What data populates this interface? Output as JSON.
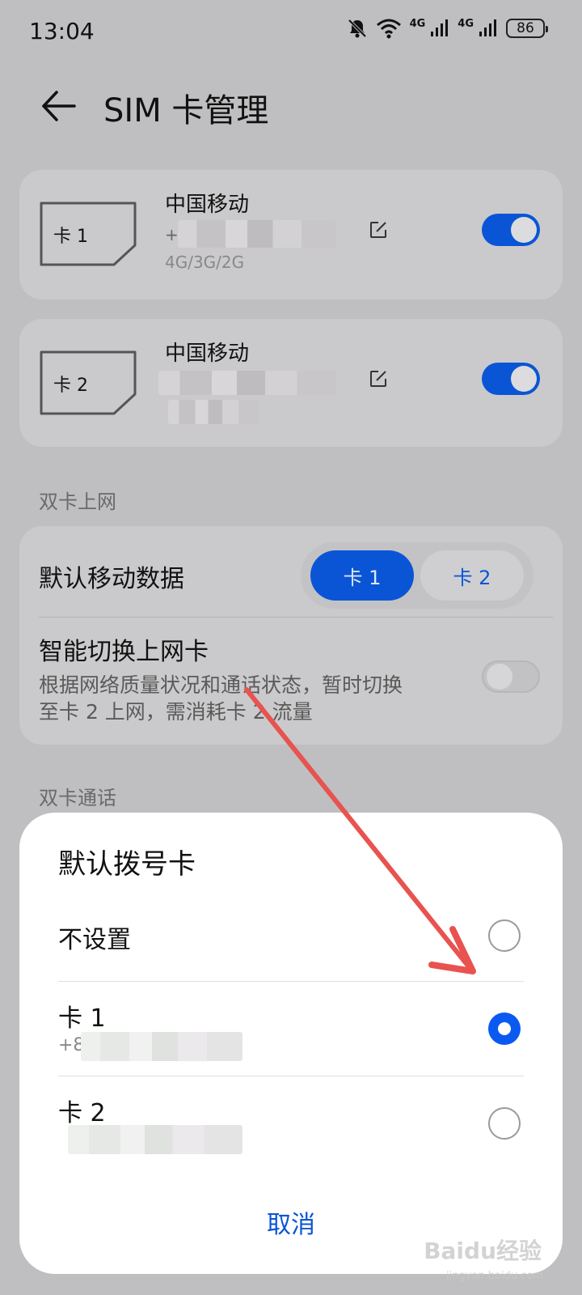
{
  "status_bar": {
    "time": "13:04",
    "net1": "4G",
    "net2": "4G",
    "battery": "86"
  },
  "header": {
    "title": "SIM 卡管理"
  },
  "sim1": {
    "label": "卡 1",
    "carrier": "中国移动",
    "number_prefix": "+",
    "network": "4G/3G/2G",
    "enabled": true
  },
  "sim2": {
    "label": "卡 2",
    "carrier": "中国移动",
    "enabled": true
  },
  "dual_data": {
    "section": "双卡上网",
    "default_data_label": "默认移动数据",
    "seg_card1": "卡 1",
    "seg_card2": "卡 2",
    "selected": "卡 1",
    "smart_switch_title": "智能切换上网卡",
    "smart_switch_desc1": "根据网络质量状况和通话状态，暂时切换",
    "smart_switch_desc2": "至卡 2 上网，需消耗卡 2 流量",
    "smart_switch_enabled": false
  },
  "dual_call": {
    "section": "双卡通话"
  },
  "dialog": {
    "title": "默认拨号卡",
    "options": [
      {
        "label": "不设置",
        "selected": false
      },
      {
        "label": "卡 1",
        "sub_prefix": "+8",
        "selected": true
      },
      {
        "label": "卡 2",
        "selected": false
      }
    ],
    "cancel": "取消"
  },
  "colors": {
    "accent": "#0a55d6",
    "arrow": "#e8534f"
  },
  "watermark": {
    "text": "Baidu经验",
    "sub": "jingyan.baidu.com"
  }
}
